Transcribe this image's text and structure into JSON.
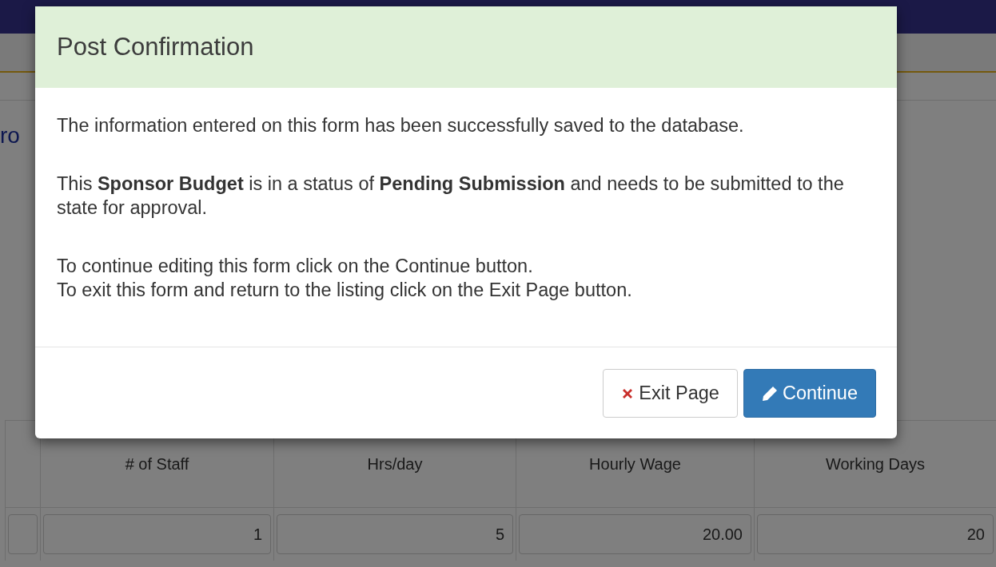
{
  "page": {
    "heading": "ro",
    "table": {
      "columns": [
        "# of Staff",
        "Hrs/day",
        "Hourly Wage",
        "Working Days"
      ],
      "values": [
        "1",
        "5",
        "20.00",
        "20"
      ]
    }
  },
  "modal": {
    "title": "Post Confirmation",
    "paragraphs": [
      [
        "The information entered on this form has been successfully saved to the database."
      ],
      [
        "This **Sponsor Budget** is in a status of **Pending Submission** and needs to be submitted to the state for approval."
      ],
      [
        "To continue editing this form click on the Continue button.",
        "To exit this form and return to the listing click on the Exit Page button."
      ]
    ],
    "buttons": [
      {
        "label": "Exit Page",
        "kind": "exit"
      },
      {
        "label": "Continue",
        "kind": "continue"
      }
    ]
  }
}
